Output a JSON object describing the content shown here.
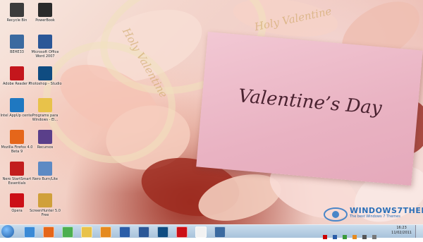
{
  "wallpaper": {
    "card_title": "Valentine’s Day",
    "deco_text_1": "Holy Valentine",
    "deco_text_2": "Holy Valentine"
  },
  "desktop_icons": [
    {
      "label": "Recycle Bin",
      "icon": "recycle-bin-icon",
      "color": "#3c3c3c"
    },
    {
      "label": "PowerBook",
      "icon": "notebook-icon",
      "color": "#2b2b2b"
    },
    {
      "label": "BEHE33",
      "icon": "computer-icon",
      "color": "#3b6aa0"
    },
    {
      "label": "Microsoft Office Word 2007",
      "icon": "word-icon",
      "color": "#2b5797"
    },
    {
      "label": "Adobe Reader X",
      "icon": "pdf-icon",
      "color": "#c4161c"
    },
    {
      "label": "Photoshop - Studio",
      "icon": "photoshop-icon",
      "color": "#0f4c81"
    },
    {
      "label": "Intel AppUp center",
      "icon": "intel-icon",
      "color": "#1f78c1"
    },
    {
      "label": "Programs para Windows - El...",
      "icon": "folder-icon",
      "color": "#e8c24a"
    },
    {
      "label": "Mozilla Firefox 4.0 Beta 9",
      "icon": "firefox-icon",
      "color": "#e5661a"
    },
    {
      "label": "Recursos",
      "icon": "resources-icon",
      "color": "#5a3f8a"
    },
    {
      "label": "Nero StartSmart Essentials",
      "icon": "nero-icon",
      "color": "#c21e1e"
    },
    {
      "label": "Nero Burn/Lite",
      "icon": "burn-icon",
      "color": "#5d8ac4"
    },
    {
      "label": "Opera",
      "icon": "opera-icon",
      "color": "#cc0f16"
    },
    {
      "label": "ScreenHunter 5.0 Free",
      "icon": "screenhunter-icon",
      "color": "#d0a03a"
    }
  ],
  "watermark": {
    "brand": "WINDOWS7THEME.NET",
    "site": "The best Windows 7 Themes",
    "brand_color": "#2a6fb8"
  },
  "taskbar": {
    "start_icon": "windows-start-icon",
    "pinned": [
      {
        "icon": "internet-explorer-icon",
        "color": "#3a8ad6"
      },
      {
        "icon": "firefox-icon",
        "color": "#e5661a"
      },
      {
        "icon": "chrome-icon",
        "color": "#4caf50"
      },
      {
        "icon": "explorer-folder-icon",
        "color": "#e8c24a"
      },
      {
        "icon": "media-player-icon",
        "color": "#e58a1f"
      },
      {
        "icon": "video-icon",
        "color": "#2a5da8"
      },
      {
        "icon": "word-icon",
        "color": "#2b5797"
      },
      {
        "icon": "photoshop-icon",
        "color": "#0f4c81"
      },
      {
        "icon": "opera-icon",
        "color": "#cc0f16"
      },
      {
        "icon": "notepad-icon",
        "color": "#f2f2f2"
      },
      {
        "icon": "screen-icon",
        "color": "#3b6aa0"
      }
    ],
    "clock_time": "16:23",
    "clock_date": "11/02/2011"
  }
}
